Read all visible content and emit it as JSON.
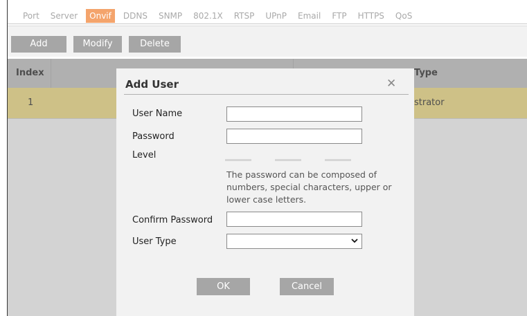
{
  "tabs": [
    {
      "label": "Port"
    },
    {
      "label": "Server"
    },
    {
      "label": "Onvif",
      "active": true
    },
    {
      "label": "DDNS"
    },
    {
      "label": "SNMP"
    },
    {
      "label": "802.1X"
    },
    {
      "label": "RTSP"
    },
    {
      "label": "UPnP"
    },
    {
      "label": "Email"
    },
    {
      "label": "FTP"
    },
    {
      "label": "HTTPS"
    },
    {
      "label": "QoS"
    }
  ],
  "toolbar": {
    "add_label": "Add",
    "modify_label": "Modify",
    "delete_label": "Delete"
  },
  "table": {
    "headers": {
      "index": "Index",
      "type": "Type"
    },
    "rows": [
      {
        "index": "1",
        "type": "strator"
      }
    ]
  },
  "dialog": {
    "title": "Add User",
    "close_icon": "close-icon",
    "fields": {
      "user_name_label": "User Name",
      "user_name_value": "",
      "password_label": "Password",
      "password_value": "",
      "level_label": "Level",
      "hint": "The password can be composed of numbers, special characters, upper or lower case letters.",
      "confirm_label": "Confirm Password",
      "confirm_value": "",
      "user_type_label": "User Type",
      "user_type_value": ""
    },
    "ok_label": "OK",
    "cancel_label": "Cancel"
  },
  "colors": {
    "active_tab": "#f4a46c",
    "selected_row": "#f8e38a",
    "button": "#a6a6a6"
  }
}
